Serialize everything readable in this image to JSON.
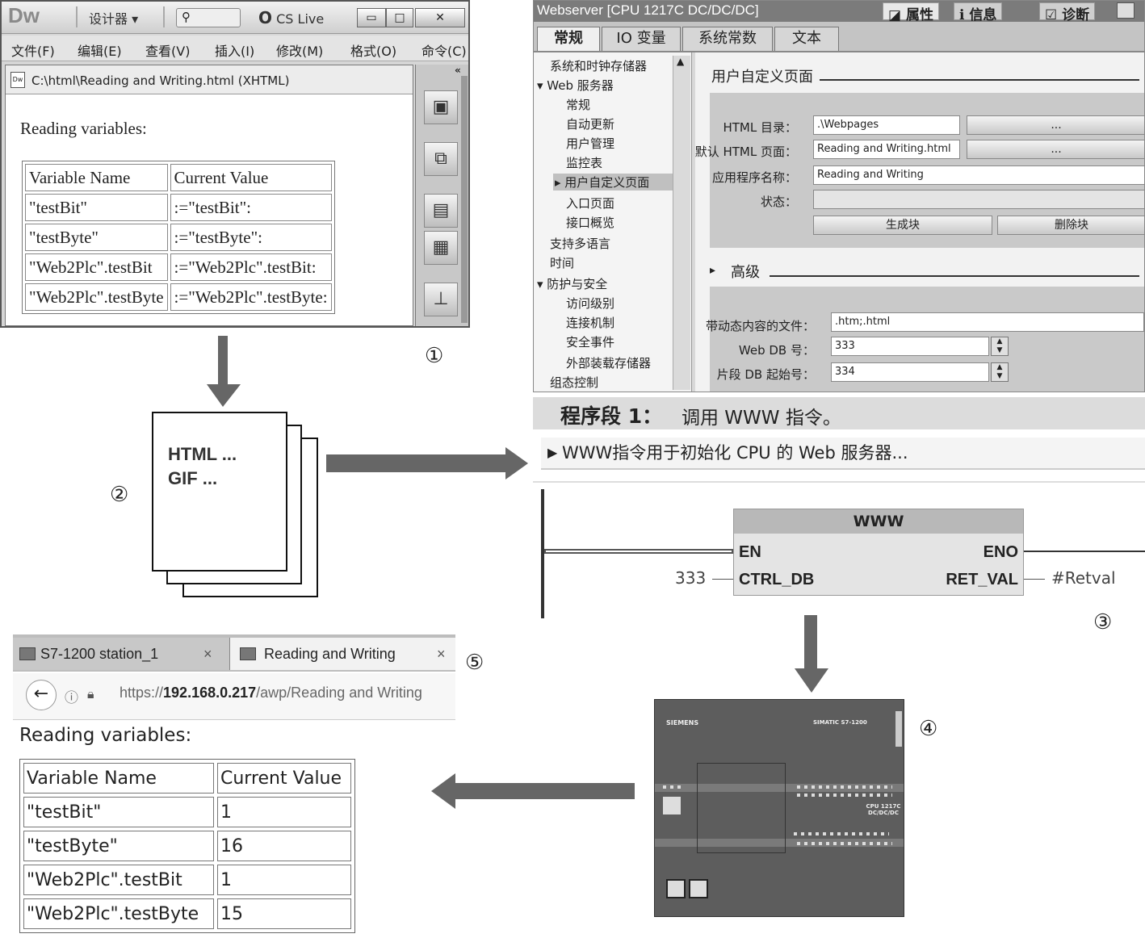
{
  "dreamweaver": {
    "logo": "Dw",
    "workspace": "设计器",
    "cs_live": "CS Live",
    "window_buttons": [
      "▭",
      "□",
      "✕"
    ],
    "menu": [
      "文件(F)",
      "编辑(E)",
      "查看(V)",
      "插入(I)",
      "修改(M)",
      "格式(O)",
      "命令(C)"
    ],
    "doc_path": "C:\\html\\Reading and Writing.html (XHTML)",
    "heading": "Reading variables:",
    "table": {
      "headers": [
        "Variable Name",
        "Current Value"
      ],
      "rows": [
        [
          "\"testBit\"",
          ":=\"testBit\":"
        ],
        [
          "\"testByte\"",
          ":=\"testByte\":"
        ],
        [
          "\"Web2Plc\".testBit",
          ":=\"Web2Plc\".testBit:"
        ],
        [
          "\"Web2Plc\".testByte",
          ":=\"Web2Plc\".testByte:"
        ]
      ]
    }
  },
  "files": {
    "line1": "HTML ...",
    "line2": "GIF ..."
  },
  "tia": {
    "title": "Webserver [CPU 1217C DC/DC/DC]",
    "header_tabs": [
      "属性",
      "信息",
      "诊断"
    ],
    "tabs": [
      "常规",
      "IO 变量",
      "系统常数",
      "文本"
    ],
    "nav": [
      {
        "label": "系统和时钟存储器",
        "indent": 0
      },
      {
        "label": "▾ Web 服务器",
        "indent": 0
      },
      {
        "label": "常规",
        "indent": 2
      },
      {
        "label": "自动更新",
        "indent": 2
      },
      {
        "label": "用户管理",
        "indent": 2
      },
      {
        "label": "监控表",
        "indent": 2
      },
      {
        "label": "▸ 用户自定义页面",
        "indent": 1
      },
      {
        "label": "入口页面",
        "indent": 2
      },
      {
        "label": "接口概览",
        "indent": 2
      },
      {
        "label": "支持多语言",
        "indent": 0
      },
      {
        "label": "时间",
        "indent": 0
      },
      {
        "label": "▾ 防护与安全",
        "indent": 0
      },
      {
        "label": "访问级别",
        "indent": 2
      },
      {
        "label": "连接机制",
        "indent": 2
      },
      {
        "label": "安全事件",
        "indent": 2
      },
      {
        "label": "外部装载存储器",
        "indent": 2
      },
      {
        "label": "组态控制",
        "indent": 0
      }
    ],
    "section_user_pages": "用户自定义页面",
    "html_dir_label": "HTML 目录：",
    "html_dir_value": ".\\Webpages",
    "default_page_label": "默认 HTML 页面：",
    "default_page_value": "Reading and Writing.html",
    "app_name_label": "应用程序名称：",
    "app_name_value": "Reading and Writing",
    "status_label": "状态：",
    "browse_label": "...",
    "generate_label": "生成块",
    "delete_label": "删除块",
    "section_advanced": "高级",
    "dyn_files_label": "带动态内容的文件：",
    "dyn_files_value": ".htm;.html",
    "web_db_label": "Web DB 号：",
    "web_db_value": "333",
    "frag_db_label": "片段 DB 起始号：",
    "frag_db_value": "334"
  },
  "segment": {
    "title": "程序段 1：",
    "subtitle": "调用 WWW 指令。",
    "description": "WWW指令用于初始化 CPU 的 Web 服务器...",
    "block_name": "WWW",
    "pin_en": "EN",
    "pin_eno": "ENO",
    "pin_ctrl": "CTRL_DB",
    "pin_ret": "RET_VAL",
    "ctrl_value": "333",
    "ret_value": "#Retval"
  },
  "plc": {
    "brand": "SIEMENS",
    "model": "SIMATIC S7-1200",
    "cpu": "CPU 1217C DC/DC/DC"
  },
  "browser": {
    "tab1": "S7-1200 station_1",
    "tab2": "Reading and Writing",
    "close": "×",
    "back": "←",
    "url_prefix": "https://",
    "url_host": "192.168.0.217",
    "url_path": "/awp/Reading and Writing",
    "heading": "Reading variables:",
    "table": {
      "headers": [
        "Variable Name",
        "Current Value"
      ],
      "rows": [
        [
          "\"testBit\"",
          "1"
        ],
        [
          "\"testByte\"",
          "16"
        ],
        [
          "\"Web2Plc\".testBit",
          "1"
        ],
        [
          "\"Web2Plc\".testByte",
          "15"
        ]
      ]
    }
  },
  "markers": [
    "①",
    "②",
    "③",
    "④",
    "⑤"
  ]
}
